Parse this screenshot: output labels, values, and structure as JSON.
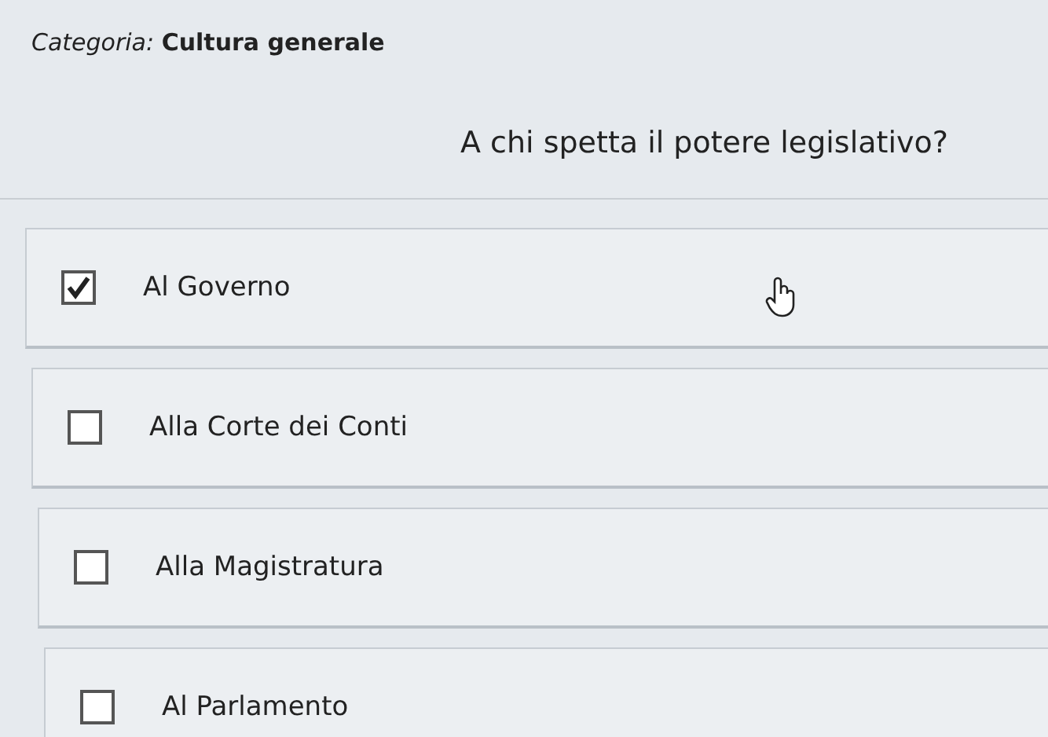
{
  "category": "*Categoria:* **Cultura generale**",
  "question": "A chi spetta il potere legislativo?",
  "options": [
    {
      "label": "Al Governo",
      "checked": true
    },
    {
      "label": "Alla Corte dei Conti",
      "checked": false
    },
    {
      "label": "Alla Magistratura",
      "checked": false
    },
    {
      "label": "Al Parlamento",
      "checked": false
    }
  ]
}
